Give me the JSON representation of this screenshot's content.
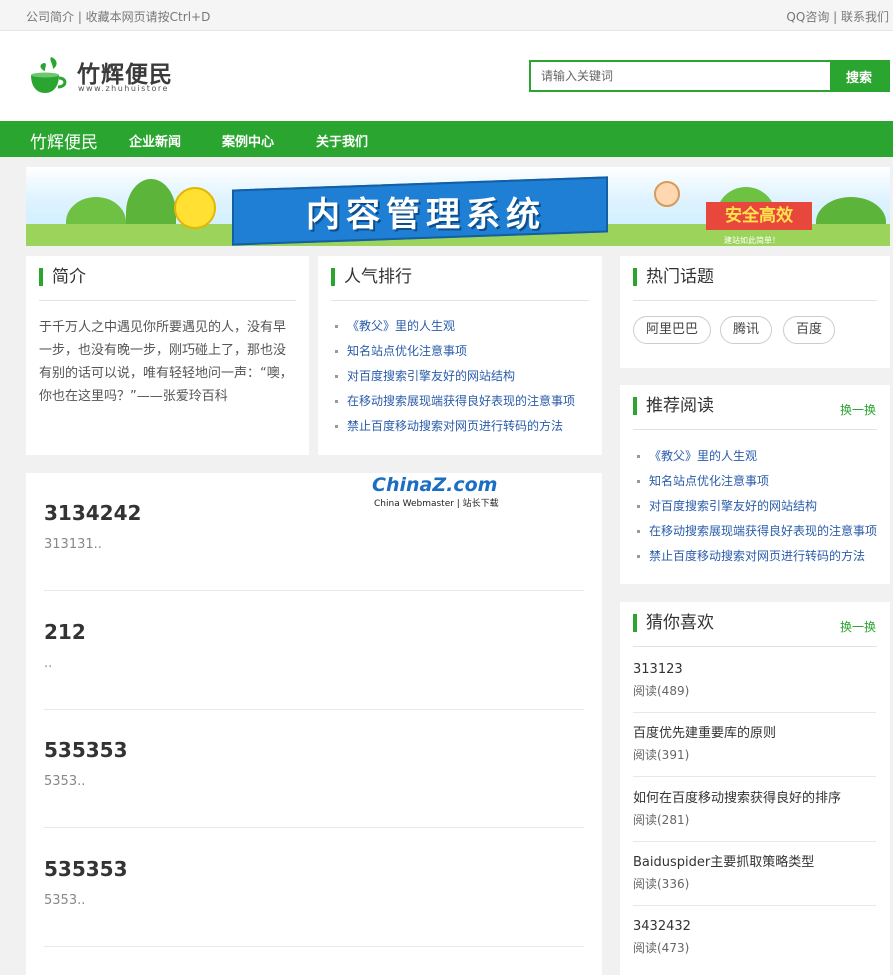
{
  "topbar": {
    "left": "公司简介 | 收藏本网页请按Ctrl+D",
    "right": "QQ咨询 | 联系我们"
  },
  "header": {
    "logo_name": "竹辉便民",
    "logo_sub": "www.zhuhuistore",
    "search_placeholder": "请输入关键词",
    "search_button": "搜索"
  },
  "nav": {
    "brand": "竹辉便民",
    "items": [
      "企业新闻",
      "案例中心",
      "关于我们"
    ]
  },
  "banner": {
    "headline": "内容管理系统",
    "tag": "安全高效",
    "small": "建站如此简单！"
  },
  "intro": {
    "title": "简介",
    "text": "于千万人之中遇见你所要遇见的人，没有早一步，也没有晚一步，刚巧碰上了，那也没有别的话可以说，唯有轻轻地问一声：“噢，你也在这里吗？”——张爱玲百科"
  },
  "popular": {
    "title": "人气排行",
    "items": [
      "《教父》里的人生观",
      "知名站点优化注意事项",
      "对百度搜索引擎友好的网站结构",
      "在移动搜索展现端获得良好表现的注意事项",
      "禁止百度移动搜索对网页进行转码的方法"
    ]
  },
  "topics": {
    "title": "热门话题",
    "tags": [
      "阿里巴巴",
      "腾讯",
      "百度"
    ]
  },
  "recommend": {
    "title": "推荐阅读",
    "more": "换一换",
    "items": [
      "《教父》里的人生观",
      "知名站点优化注意事项",
      "对百度搜索引擎友好的网站结构",
      "在移动搜索展现端获得良好表现的注意事项",
      "禁止百度移动搜索对网页进行转码的方法"
    ]
  },
  "watermark": {
    "main": "ChinaZ.com",
    "sub": "China Webmaster | 站长下载"
  },
  "posts": [
    {
      "title": "3134242",
      "summary": "313131.."
    },
    {
      "title": "212",
      "summary": ".."
    },
    {
      "title": "535353",
      "summary": "5353.."
    },
    {
      "title": "535353",
      "summary": "5353.."
    }
  ],
  "guess": {
    "title": "猜你喜欢",
    "more": "换一换",
    "items": [
      {
        "title": "313123",
        "meta": "阅读(489)"
      },
      {
        "title": "百度优先建重要库的原则",
        "meta": "阅读(391)"
      },
      {
        "title": "如何在百度移动搜索获得良好的排序",
        "meta": "阅读(281)"
      },
      {
        "title": "Baiduspider主要抓取策略类型",
        "meta": "阅读(336)"
      },
      {
        "title": "3432432",
        "meta": "阅读(473)"
      }
    ]
  },
  "colors": {
    "accent": "#2aa52f",
    "link": "#2a5caa"
  }
}
